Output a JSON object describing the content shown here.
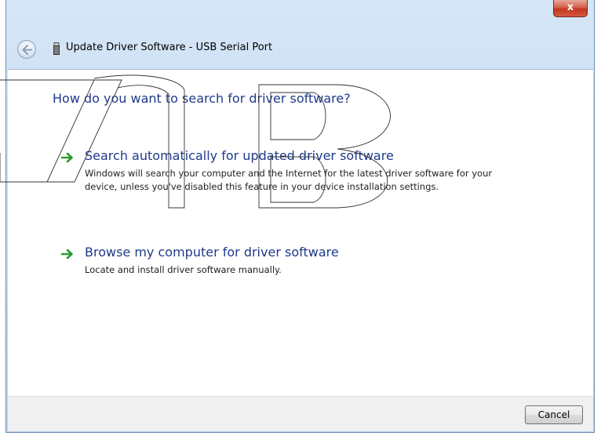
{
  "window": {
    "title": "Update Driver Software - USB Serial Port",
    "close_label": "x"
  },
  "icons": {
    "back": "back-arrow-icon",
    "device": "usb-device-icon",
    "option_arrow": "green-arrow-icon"
  },
  "content": {
    "heading": "How do you want to search for driver software?",
    "options": [
      {
        "title": "Search automatically for updated driver software",
        "description": "Windows will search your computer and the Internet for the latest driver software for your device, unless you've disabled this feature in your device installation settings."
      },
      {
        "title": "Browse my computer for driver software",
        "description": "Locate and install driver software manually."
      }
    ]
  },
  "footer": {
    "cancel_label": "Cancel"
  },
  "colors": {
    "link_blue": "#1e3a8a",
    "arrow_green": "#2e9a2e",
    "close_red": "#c2381f"
  }
}
